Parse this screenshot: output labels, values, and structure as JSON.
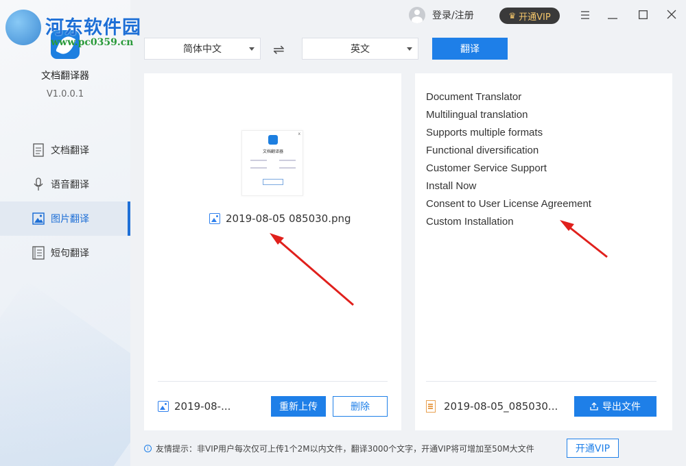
{
  "watermark": {
    "title": "河东软件园",
    "url": "www.pc0359.cn"
  },
  "app": {
    "name": "文档翻译器",
    "version": "V1.0.0.1"
  },
  "sidebar": {
    "items": [
      {
        "label": "文档翻译",
        "icon": "document-icon",
        "active": false
      },
      {
        "label": "语音翻译",
        "icon": "microphone-icon",
        "active": false
      },
      {
        "label": "图片翻译",
        "icon": "image-icon",
        "active": true
      },
      {
        "label": "短句翻译",
        "icon": "sentence-icon",
        "active": false
      }
    ]
  },
  "titlebar": {
    "login_label": "登录/注册",
    "vip_label": "开通VIP"
  },
  "language": {
    "source": "简体中文",
    "target": "英文",
    "translate_label": "翻译"
  },
  "left_panel": {
    "thumbnail_title": "文档翻译器",
    "file_name": "2019-08-05  085030.png",
    "bottom_file": "2019-08-...",
    "reupload_label": "重新上传",
    "delete_label": "删除"
  },
  "right_panel": {
    "lines": [
      "Document Translator",
      "Multilingual translation",
      "Supports multiple formats",
      "Functional diversification",
      "Customer Service Support",
      "Install Now",
      "Consent to User License Agreement",
      "Custom Installation"
    ],
    "bottom_file": "2019-08-05_085030...",
    "export_label": "导出文件"
  },
  "footer": {
    "tip": "友情提示：非VIP用户每次仅可上传1个2M以内文件，翻译3000个文字，开通VIP将可增加至50M大文件",
    "vip_label": "开通VIP"
  },
  "colors": {
    "accent": "#1e7fe8",
    "arrow": "#e0201c",
    "vip_gold": "#f5c76b"
  }
}
